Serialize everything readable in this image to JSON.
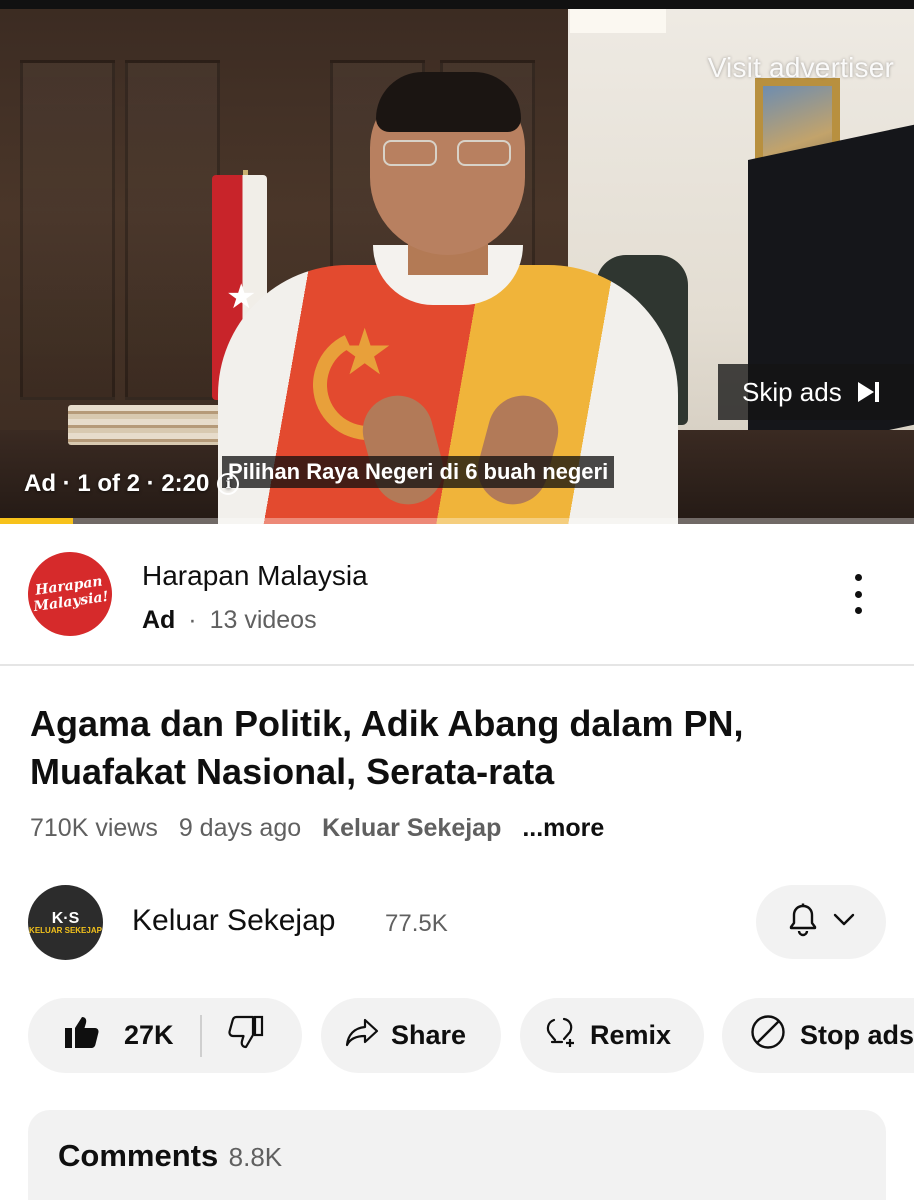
{
  "player": {
    "visit_advertiser": "Visit advertiser",
    "skip_ads": "Skip ads",
    "ad_meta": "Ad · 1 of 2 · 2:20",
    "subtitle": "Pilihan Raya Negeri di 6 buah negeri",
    "progress_fraction": 0.08,
    "progress_color": "#f7c21b"
  },
  "advertiser": {
    "logo_line1": "Harapan",
    "logo_line2": "Malaysia!",
    "name": "Harapan Malaysia",
    "ad_label": "Ad",
    "separator": "·",
    "videos": "13 videos",
    "logo_color": "#d62a2b"
  },
  "video": {
    "title": "Agama dan Politik, Adik Abang dalam PN, Muafakat Nasional, Serata-rata",
    "views": "710K views",
    "age": "9 days ago",
    "channel_link": "Keluar Sekejap",
    "more": "...more"
  },
  "channel": {
    "avatar_text": "K·S",
    "avatar_sub": "KELUAR SEKEJAP",
    "name": "Keluar Sekejap",
    "subscribers": "77.5K"
  },
  "actions": {
    "likes": "27K",
    "share": "Share",
    "remix": "Remix",
    "stop_ads": "Stop ads"
  },
  "comments": {
    "label": "Comments",
    "count": "8.8K"
  },
  "icons": [
    "info-icon",
    "skip-next-icon",
    "more-vert-icon",
    "bell-icon",
    "chevron-down-icon",
    "thumb-up-icon",
    "thumb-down-icon",
    "share-icon",
    "remix-icon",
    "block-icon"
  ]
}
